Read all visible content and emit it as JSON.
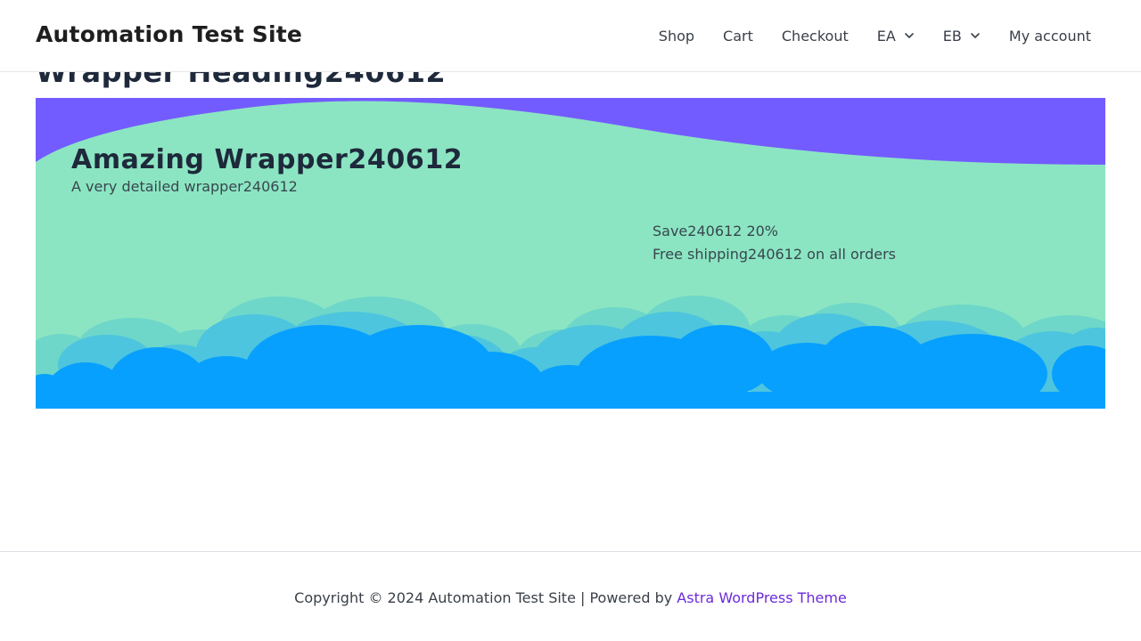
{
  "header": {
    "site_title": "Automation Test Site",
    "nav": {
      "shop": "Shop",
      "cart": "Cart",
      "checkout": "Checkout",
      "ea": "EA",
      "eb": "EB",
      "my_account": "My account"
    }
  },
  "main": {
    "page_heading": "Wrapper Heading240612",
    "hero": {
      "title": "Amazing Wrapper240612",
      "subtitle": "A very detailed wrapper240612",
      "promo_line_1": "Save240612 20%",
      "promo_line_2": "Free shipping240612 on all orders"
    }
  },
  "footer": {
    "copyright_text": "Copyright © 2024 Automation Test Site | Powered by ",
    "theme_link": "Astra WordPress Theme"
  },
  "colors": {
    "hero_background": "#8ce5c2",
    "top_wave": "#735cff",
    "cloud_light": "#6ed7c9",
    "cloud_mid": "#4ec5de",
    "cloud_front": "#08a0ff",
    "link": "#6b2bd9"
  },
  "icons": {
    "dropdown": "chevron-down-icon"
  }
}
